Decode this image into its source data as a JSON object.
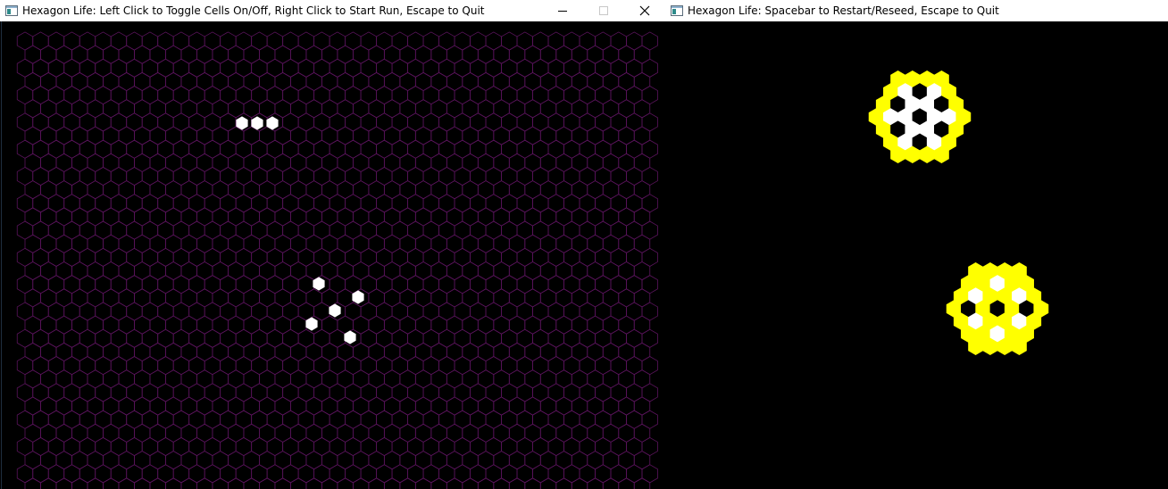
{
  "left_window": {
    "title": "Hexagon Life: Left Click to Toggle Cells On/Off, Right Click to Start Run, Escape to Quit",
    "icon": "app-window-icon",
    "buttons": {
      "minimize": "minimize-icon",
      "maximize": "maximize-icon",
      "close": "close-icon"
    },
    "grid_color": "#5a145c",
    "live_cell_color": "#ffffff"
  },
  "right_window": {
    "title": "Hexagon Life: Spacebar to Restart/Reseed, Escape to Quit",
    "icon": "app-window-icon",
    "cell_color_white": "#ffffff",
    "cell_color_yellow": "#ffff00"
  }
}
